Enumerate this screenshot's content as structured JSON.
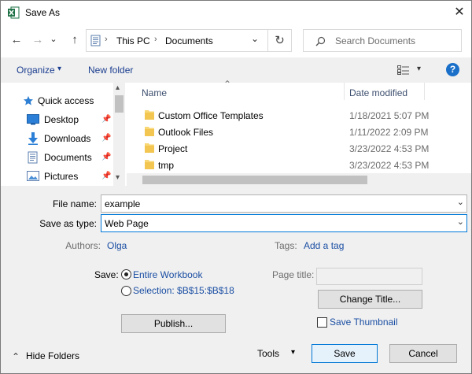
{
  "window": {
    "title": "Save As",
    "close_glyph": "✕"
  },
  "nav": {
    "back_glyph": "←",
    "forward_glyph": "→",
    "recent_glyph": "⌄",
    "up_glyph": "↑",
    "refresh_glyph": "↻",
    "breadcrumb": [
      "This PC",
      "Documents"
    ],
    "breadcrumb_sep": "›",
    "address_dropdown_glyph": "⌄",
    "search_placeholder": "Search Documents"
  },
  "toolbar": {
    "organize_label": "Organize",
    "organize_arrow": "▾",
    "new_folder_label": "New folder",
    "view_arrow": "▾",
    "help_glyph": "?"
  },
  "sidebar": {
    "items": [
      {
        "label": "Quick access",
        "icon": "star-icon"
      },
      {
        "label": "Desktop",
        "icon": "desktop-icon",
        "pinned": true
      },
      {
        "label": "Downloads",
        "icon": "download-arrow-icon",
        "pinned": true
      },
      {
        "label": "Documents",
        "icon": "documents-icon",
        "pinned": true
      },
      {
        "label": "Pictures",
        "icon": "pictures-icon",
        "pinned": true
      }
    ],
    "pin_glyph": "📌",
    "scroll_up_glyph": "▴",
    "scroll_down_glyph": "▾"
  },
  "files": {
    "columns": {
      "name": "Name",
      "date": "Date modified",
      "sort_glyph": "⌃"
    },
    "rows": [
      {
        "name": "Custom Office Templates",
        "date": "1/18/2021 5:07 PM"
      },
      {
        "name": "Outlook Files",
        "date": "1/11/2022 2:09 PM"
      },
      {
        "name": "Project",
        "date": "3/23/2022 4:53 PM"
      },
      {
        "name": "tmp",
        "date": "3/23/2022 4:53 PM"
      }
    ]
  },
  "form": {
    "file_name_label": "File name:",
    "file_name_value": "example",
    "save_as_type_label": "Save as type:",
    "save_as_type_value": "Web Page",
    "combo_arrow": "⌄",
    "authors_label": "Authors:",
    "authors_value": "Olga",
    "tags_label": "Tags:",
    "tags_value": "Add a tag",
    "save_label": "Save:",
    "radio_entire": "Entire Workbook",
    "radio_selection": "Selection: $B$15:$B$18",
    "page_title_label": "Page title:",
    "change_title_button": "Change Title...",
    "publish_button": "Publish...",
    "save_thumbnail_label": "Save Thumbnail"
  },
  "footer": {
    "hide_folders_glyph": "⌃",
    "hide_folders_label": "Hide Folders",
    "tools_label": "Tools",
    "tools_arrow": "▾",
    "save_button": "Save",
    "cancel_button": "Cancel"
  },
  "colors": {
    "accent": "#0078d7",
    "link": "#1a4ea3",
    "folder": "#f8d775",
    "excel_green": "#1e7145",
    "panel": "#f0f0f0"
  }
}
